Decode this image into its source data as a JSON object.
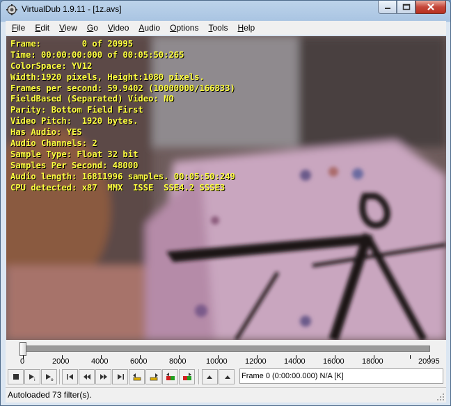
{
  "window": {
    "title": "VirtualDub 1.9.11 - [1z.avs]"
  },
  "menu": [
    {
      "label": "File",
      "accel": "F",
      "rest": "ile"
    },
    {
      "label": "Edit",
      "accel": "E",
      "rest": "dit"
    },
    {
      "label": "View",
      "accel": "V",
      "rest": "iew"
    },
    {
      "label": "Go",
      "accel": "G",
      "rest": "o"
    },
    {
      "label": "Video",
      "accel": "V",
      "rest": "ideo"
    },
    {
      "label": "Audio",
      "accel": "A",
      "rest": "udio"
    },
    {
      "label": "Options",
      "accel": "O",
      "rest": "ptions"
    },
    {
      "label": "Tools",
      "accel": "T",
      "rest": "ools"
    },
    {
      "label": "Help",
      "accel": "H",
      "rest": "elp"
    }
  ],
  "info_lines": [
    "Frame:        0 of 20995",
    "Time: 00:00:00:000 of 00:05:50:265",
    "ColorSpace: YV12",
    "Width:1920 pixels, Height:1080 pixels.",
    "Frames per second: 59.9402 (10000000/166833)",
    "FieldBased (Separated) Video: NO",
    "Parity: Bottom Field First",
    "Video Pitch:  1920 bytes.",
    "Has Audio: YES",
    "Audio Channels: 2",
    "Sample Type: Float 32 bit",
    "Samples Per Second: 48000",
    "Audio length: 16811996 samples. 00:05:50:249",
    "CPU detected: x87  MMX  ISSE  SSE4.2 SSSE3"
  ],
  "timeline": {
    "position": 0,
    "max": 20995,
    "tick_labels": [
      "0",
      "2000",
      "4000",
      "6000",
      "8000",
      "10000",
      "12000",
      "14000",
      "16000",
      "18000",
      "20995"
    ]
  },
  "frame_readout": "Frame 0 (0:00:00.000) N/A [K]",
  "status": "Autoloaded 73 filter(s).",
  "icons": {
    "app": "virtualdub-gear-icon",
    "minimize": "minimize-icon",
    "maximize": "maximize-icon",
    "close": "close-icon"
  },
  "colors": {
    "overlay_text": "#ffff40",
    "close_button": "#c5473b"
  }
}
